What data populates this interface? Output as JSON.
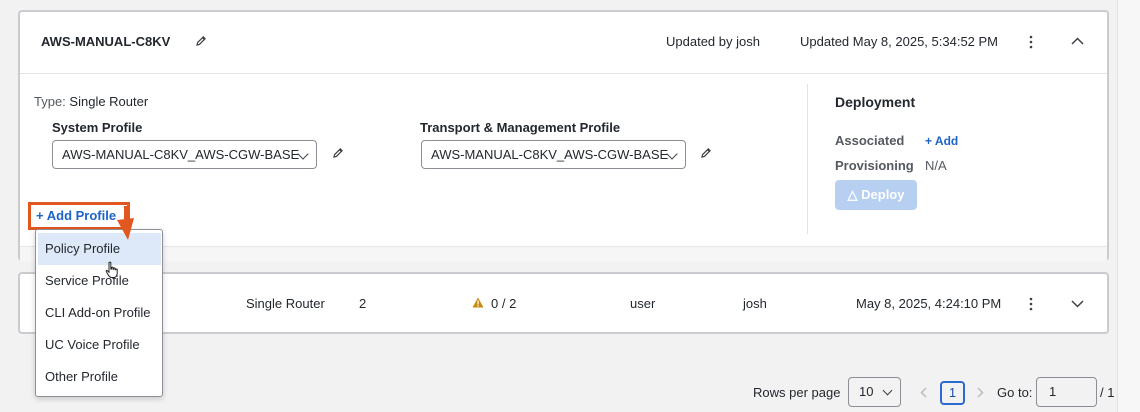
{
  "card1": {
    "title": "AWS-MANUAL-C8KV",
    "updated_by": "Updated by josh",
    "updated_at": "Updated May 8, 2025, 5:34:52 PM",
    "type_label": "Type:",
    "type_value": "Single Router",
    "system_profile_label": "System Profile",
    "system_profile_value": "AWS-MANUAL-C8KV_AWS-CGW-BASE",
    "transport_profile_label": "Transport & Management Profile",
    "transport_profile_value": "AWS-MANUAL-C8KV_AWS-CGW-BASE",
    "add_profile_label": "Add Profile"
  },
  "deployment": {
    "heading": "Deployment",
    "associated_label": "Associated",
    "associated_add": "Add",
    "provisioning_label": "Provisioning",
    "provisioning_value": "N/A",
    "deploy_button": "Deploy"
  },
  "add_profile_menu": {
    "items": [
      "Policy Profile",
      "Service Profile",
      "CLI Add-on Profile",
      "UC Voice Profile",
      "Other Profile"
    ],
    "hovered_index": 0
  },
  "row2": {
    "type": "Single Router",
    "count": "2",
    "warning": "0 / 2",
    "role": "user",
    "updated_by": "josh",
    "updated_at": "May 8, 2025, 4:24:10 PM"
  },
  "pagination": {
    "rows_per_page_label": "Rows per page",
    "rows_per_page_value": "10",
    "current_page": "1",
    "goto_label": "Go to:",
    "goto_value": "1",
    "total_pages": "/ 1"
  },
  "colors": {
    "accent": "#1d63c9",
    "highlight": "#e2571f",
    "disabled_button": "#b7cff1"
  }
}
